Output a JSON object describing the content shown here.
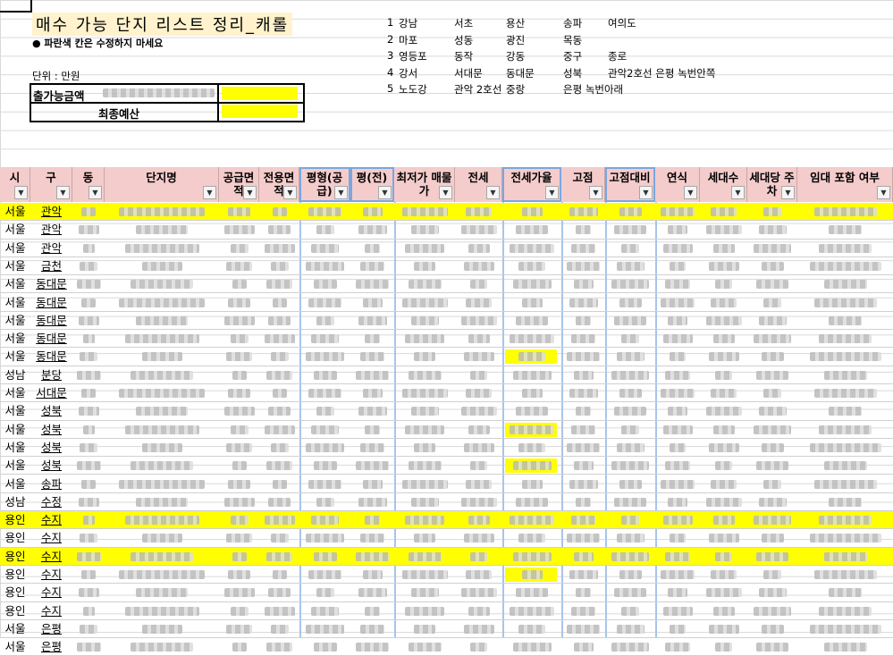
{
  "sheet": {
    "title": "매수 가능 단지 리스트 정리_캐롤",
    "note": "● 파란색 칸은 수정하지 마세요",
    "unit": "단위 : 만원",
    "box_label1": "출가능금액",
    "box_label2": "최종예산"
  },
  "regions": [
    [
      "1",
      "강남",
      "서초",
      "용산",
      "송파",
      "여의도"
    ],
    [
      "2",
      "마포",
      "성동",
      "광진",
      "목동",
      ""
    ],
    [
      "3",
      "영등포",
      "동작",
      "강동",
      "중구",
      "종로"
    ],
    [
      "4",
      "강서",
      "서대문",
      "동대문",
      "성북",
      "관악2호선 은평 녹번안쪽"
    ],
    [
      "5",
      "노도강",
      "관악 2호선",
      "중랑",
      "은평 녹번아래",
      ""
    ]
  ],
  "headers": [
    "시",
    "구",
    "동",
    "단지명",
    "공급면적",
    "전용면적",
    "평형(공급)",
    "평(전)",
    "최저가 매물가",
    "전세",
    "전세가율",
    "고점",
    "고점대비",
    "연식",
    "세대수",
    "세대당 주차",
    "임대 포함 여부"
  ],
  "rows": [
    {
      "si": "서울",
      "gu": "관악",
      "hl": true
    },
    {
      "si": "서울",
      "gu": "관악",
      "hl": false
    },
    {
      "si": "서울",
      "gu": "관악",
      "hl": false
    },
    {
      "si": "서울",
      "gu": "금천",
      "hl": false
    },
    {
      "si": "서울",
      "gu": "동대문",
      "hl": false
    },
    {
      "si": "서울",
      "gu": "동대문",
      "hl": false
    },
    {
      "si": "서울",
      "gu": "동대문",
      "hl": false
    },
    {
      "si": "서울",
      "gu": "동대문",
      "hl": false
    },
    {
      "si": "서울",
      "gu": "동대문",
      "hl": false
    },
    {
      "si": "성남",
      "gu": "분당",
      "hl": false
    },
    {
      "si": "서울",
      "gu": "서대문",
      "hl": false
    },
    {
      "si": "서울",
      "gu": "성북",
      "hl": false
    },
    {
      "si": "서울",
      "gu": "성북",
      "hl": false
    },
    {
      "si": "서울",
      "gu": "성북",
      "hl": false
    },
    {
      "si": "서울",
      "gu": "성북",
      "hl": false
    },
    {
      "si": "서울",
      "gu": "송파",
      "hl": false
    },
    {
      "si": "성남",
      "gu": "수정",
      "hl": false
    },
    {
      "si": "용인",
      "gu": "수지",
      "hl": true
    },
    {
      "si": "용인",
      "gu": "수지",
      "hl": false
    },
    {
      "si": "용인",
      "gu": "수지",
      "hl": true
    },
    {
      "si": "용인",
      "gu": "수지",
      "hl": false
    },
    {
      "si": "용인",
      "gu": "수지",
      "hl": false
    },
    {
      "si": "용인",
      "gu": "수지",
      "hl": false
    },
    {
      "si": "서울",
      "gu": "은평",
      "hl": false
    },
    {
      "si": "서울",
      "gu": "은평",
      "hl": false
    }
  ],
  "colors": {
    "header_bg": "#f4cccc",
    "highlight": "#ffff00",
    "title_bg": "#fff2cc",
    "blue_col": "#7aa7e0"
  }
}
